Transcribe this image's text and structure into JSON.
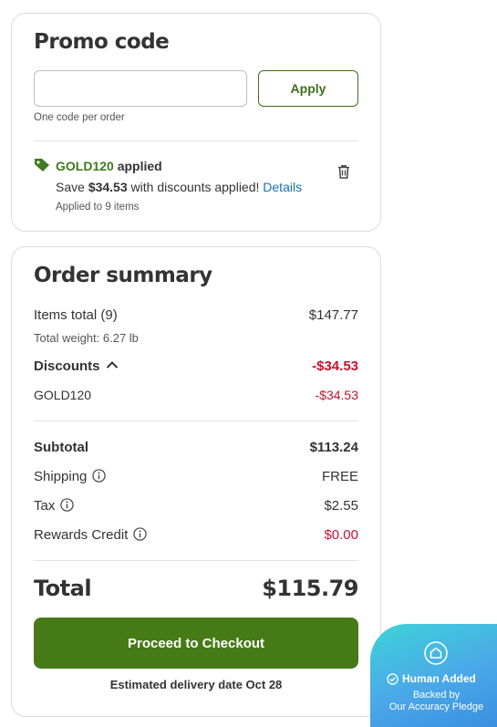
{
  "promo": {
    "title": "Promo code",
    "input_value": "",
    "input_placeholder": "",
    "apply_label": "Apply",
    "hint": "One code per order",
    "applied_code": "GOLD120",
    "applied_word": "applied",
    "save_prefix": "Save ",
    "save_amount": "$34.53",
    "save_suffix": " with discounts applied! ",
    "details_label": "Details",
    "applied_to": "Applied to 9 items"
  },
  "summary": {
    "title": "Order summary",
    "items_label": "Items total (9)",
    "items_value": "$147.77",
    "weight": "Total weight: 6.27 lb",
    "discounts_label": "Discounts",
    "discounts_value": "-$34.53",
    "discount_code": "GOLD120",
    "discount_code_value": "-$34.53",
    "subtotal_label": "Subtotal",
    "subtotal_value": "$113.24",
    "shipping_label": "Shipping",
    "shipping_value": "FREE",
    "tax_label": "Tax",
    "tax_value": "$2.55",
    "rewards_label": "Rewards Credit",
    "rewards_value": "$0.00",
    "total_label": "Total",
    "total_value": "$115.79",
    "checkout_label": "Proceed to Checkout",
    "delivery": "Estimated delivery date Oct 28"
  },
  "badge": {
    "line1": "Human Added",
    "line2": "Backed by",
    "line3": "Our Accuracy Pledge"
  },
  "colors": {
    "brand_green": "#467a16",
    "discount_red": "#c8102e",
    "link_blue": "#1a6fb5"
  }
}
